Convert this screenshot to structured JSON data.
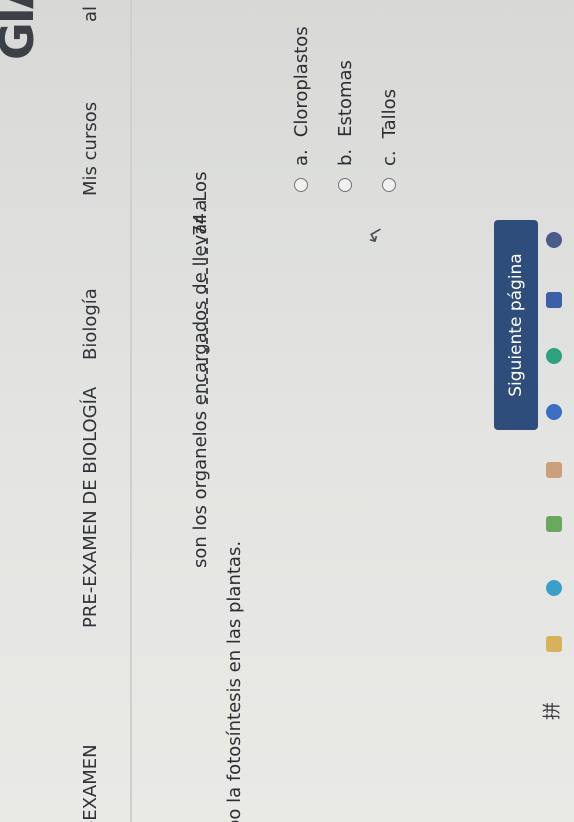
{
  "header": {
    "logo_text": "GIA"
  },
  "nav": {
    "item_partial": "al",
    "items": [
      "Mis cursos",
      "Biología",
      "PRE-EXAMEN DE BIOLOGÍA",
      "PRE-EXAMEN"
    ]
  },
  "question": {
    "number_prefix": "74. Los",
    "text_after_blank": "son los organelos encargados de llevar a",
    "text_line2": "cabo la fotosíntesis en las plantas."
  },
  "options": [
    {
      "letter": "a.",
      "label": "Cloroplastos"
    },
    {
      "letter": "b.",
      "label": "Estomas"
    },
    {
      "letter": "c.",
      "label": "Tallos"
    }
  ],
  "actions": {
    "next_label": "Siguiente página"
  },
  "taskbar": {
    "ime_label": "拼"
  },
  "colors": {
    "primary_button": "#2f4d7a",
    "page_bg": "#e6e7e4"
  }
}
